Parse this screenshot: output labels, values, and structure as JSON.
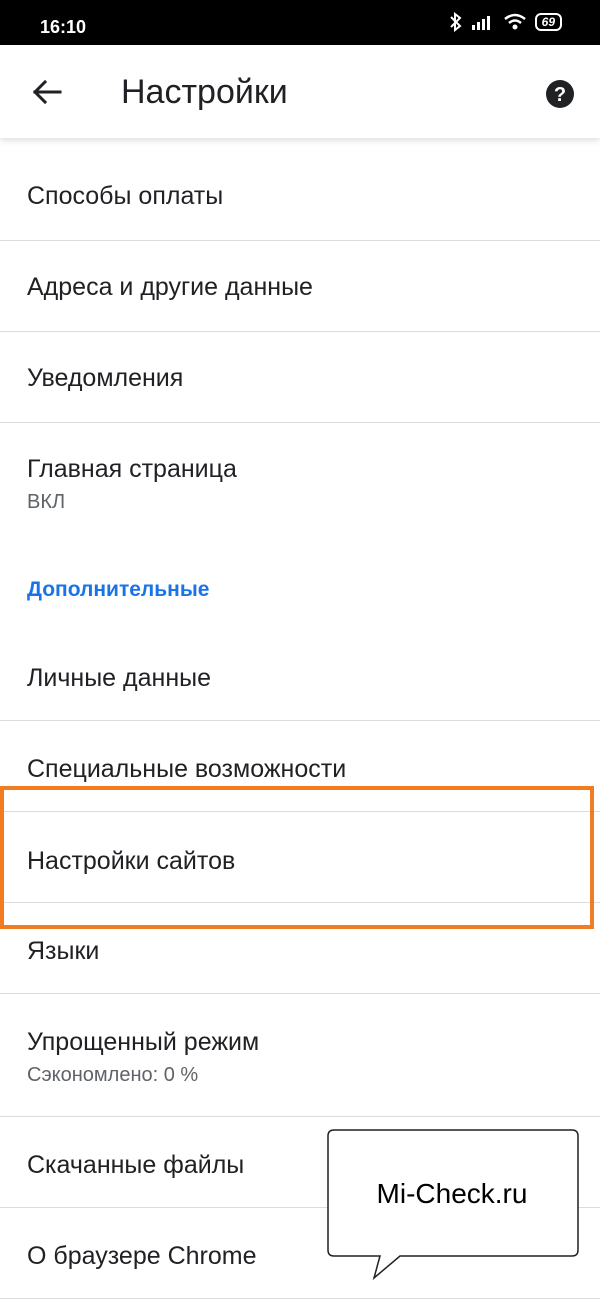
{
  "status_bar": {
    "time": "16:10",
    "battery": "69",
    "icons": [
      "bluetooth-icon",
      "signal-icon",
      "wifi-icon",
      "battery-icon"
    ]
  },
  "toolbar": {
    "title": "Настройки",
    "back_icon": "arrow-back-icon",
    "help_icon": "help-icon"
  },
  "settings": {
    "items": [
      {
        "label": "Способы оплаты"
      },
      {
        "label": "Адреса и другие данные"
      },
      {
        "label": "Уведомления"
      },
      {
        "label": "Главная страница",
        "sub": "ВКЛ"
      }
    ],
    "section_header": "Дополнительные",
    "advanced_items": [
      {
        "label": "Личные данные"
      },
      {
        "label": "Специальные возможности"
      },
      {
        "label": "Настройки сайтов"
      },
      {
        "label": "Языки"
      },
      {
        "label": "Упрощенный режим",
        "sub": "Сэкономлено: 0 %"
      },
      {
        "label": "Скачанные файлы"
      },
      {
        "label": "О браузере Chrome"
      }
    ]
  },
  "watermark": {
    "text": "Mi-Check.ru"
  },
  "colors": {
    "accent": "#1a73e8",
    "highlight": "#f47c20",
    "divider": "#dadce0"
  }
}
